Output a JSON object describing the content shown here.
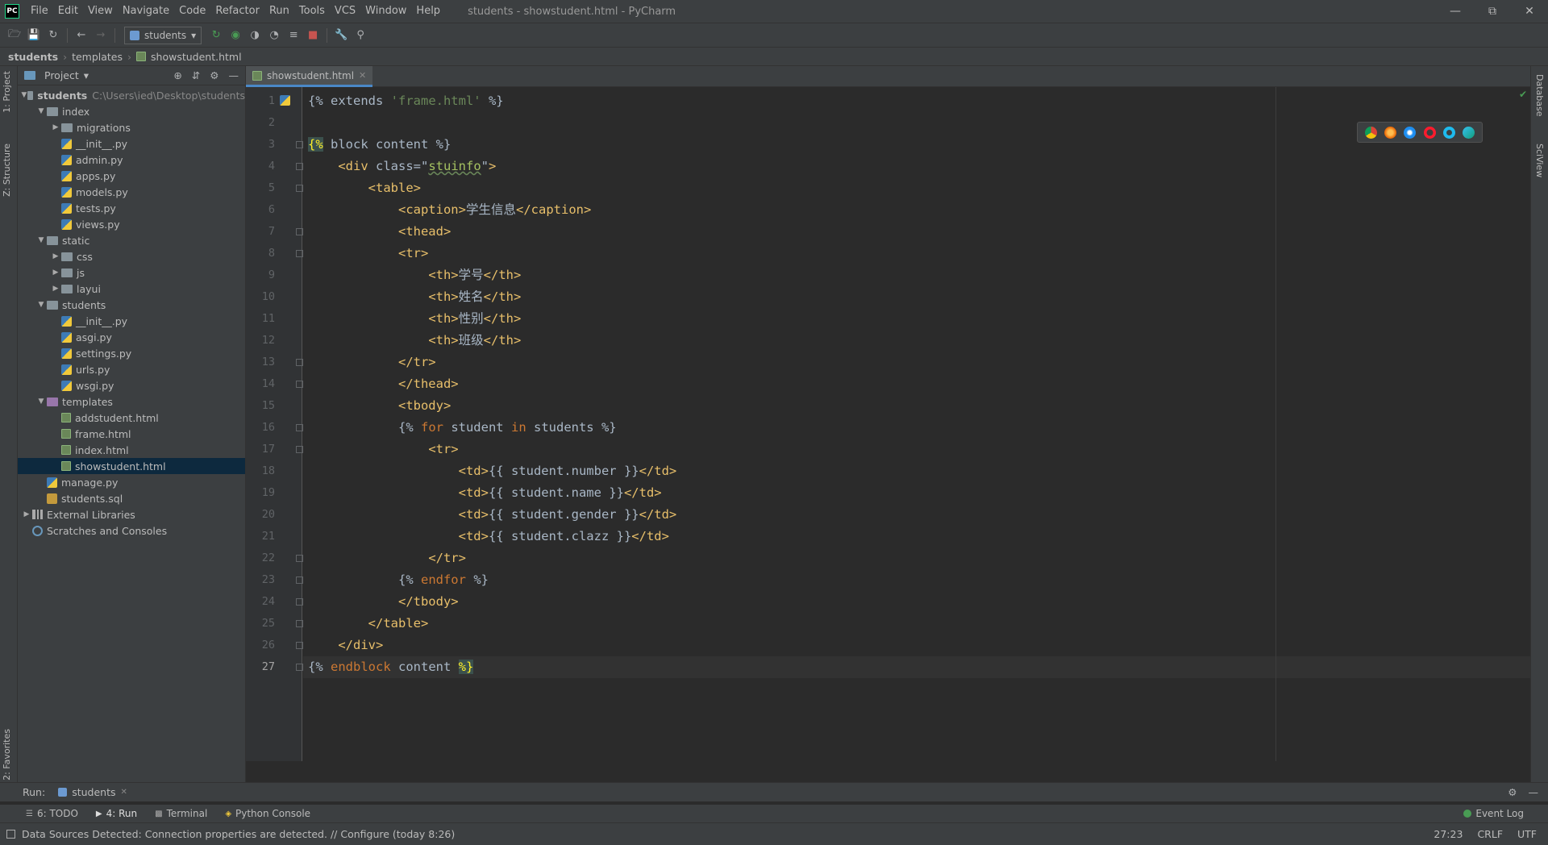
{
  "titlebar": {
    "logo": "PC",
    "menu": [
      "File",
      "Edit",
      "View",
      "Navigate",
      "Code",
      "Refactor",
      "Run",
      "Tools",
      "VCS",
      "Window",
      "Help"
    ],
    "window_title": "students - showstudent.html - PyCharm"
  },
  "toolbar": {
    "run_config": "students"
  },
  "breadcrumb": [
    "students",
    "templates",
    "showstudent.html"
  ],
  "left_strip": {
    "project_tab": "1: Project",
    "structure_tab": "Z: Structure",
    "favorites_tab": "2: Favorites"
  },
  "right_strip": {
    "database_tab": "Database",
    "sciview_tab": "SciView"
  },
  "project_panel": {
    "title": "Project",
    "root_path": "C:\\Users\\ied\\Desktop\\students",
    "tree": [
      {
        "label": "students",
        "level": 0,
        "type": "folder-root",
        "expanded": true,
        "bold": true
      },
      {
        "label": "index",
        "level": 1,
        "type": "folder",
        "expanded": true
      },
      {
        "label": "migrations",
        "level": 2,
        "type": "folder",
        "expanded": false
      },
      {
        "label": "__init__.py",
        "level": 2,
        "type": "py"
      },
      {
        "label": "admin.py",
        "level": 2,
        "type": "py"
      },
      {
        "label": "apps.py",
        "level": 2,
        "type": "py"
      },
      {
        "label": "models.py",
        "level": 2,
        "type": "py"
      },
      {
        "label": "tests.py",
        "level": 2,
        "type": "py"
      },
      {
        "label": "views.py",
        "level": 2,
        "type": "py"
      },
      {
        "label": "static",
        "level": 1,
        "type": "folder",
        "expanded": true
      },
      {
        "label": "css",
        "level": 2,
        "type": "folder",
        "expanded": false
      },
      {
        "label": "js",
        "level": 2,
        "type": "folder",
        "expanded": false
      },
      {
        "label": "layui",
        "level": 2,
        "type": "folder",
        "expanded": false
      },
      {
        "label": "students",
        "level": 1,
        "type": "folder",
        "expanded": true
      },
      {
        "label": "__init__.py",
        "level": 2,
        "type": "py"
      },
      {
        "label": "asgi.py",
        "level": 2,
        "type": "py"
      },
      {
        "label": "settings.py",
        "level": 2,
        "type": "py"
      },
      {
        "label": "urls.py",
        "level": 2,
        "type": "py"
      },
      {
        "label": "wsgi.py",
        "level": 2,
        "type": "py"
      },
      {
        "label": "templates",
        "level": 1,
        "type": "folder-purple",
        "expanded": true
      },
      {
        "label": "addstudent.html",
        "level": 2,
        "type": "html"
      },
      {
        "label": "frame.html",
        "level": 2,
        "type": "html"
      },
      {
        "label": "index.html",
        "level": 2,
        "type": "html"
      },
      {
        "label": "showstudent.html",
        "level": 2,
        "type": "html",
        "selected": true
      },
      {
        "label": "manage.py",
        "level": 1,
        "type": "py"
      },
      {
        "label": "students.sql",
        "level": 1,
        "type": "sql"
      },
      {
        "label": "External Libraries",
        "level": 0,
        "type": "lib",
        "expanded": false
      },
      {
        "label": "Scratches and Consoles",
        "level": 0,
        "type": "scratch"
      }
    ]
  },
  "editor": {
    "tab": "showstudent.html",
    "current_line": 27,
    "lines": [
      [
        {
          "t": "{% extends ",
          "c": "plain"
        },
        {
          "t": "'frame.html'",
          "c": "str"
        },
        {
          "t": " %}",
          "c": "plain"
        }
      ],
      [],
      [
        {
          "t": "{%",
          "c": "hl"
        },
        {
          "t": " block content %}",
          "c": "plain"
        }
      ],
      [
        {
          "t": "    ",
          "c": "plain"
        },
        {
          "t": "<div ",
          "c": "tag"
        },
        {
          "t": "class=",
          "c": "plain"
        },
        {
          "t": "\"",
          "c": "plain"
        },
        {
          "t": "stuinfo",
          "c": "attrv"
        },
        {
          "t": "\"",
          "c": "plain"
        },
        {
          "t": ">",
          "c": "tag"
        }
      ],
      [
        {
          "t": "        ",
          "c": "plain"
        },
        {
          "t": "<table>",
          "c": "tag"
        }
      ],
      [
        {
          "t": "            ",
          "c": "plain"
        },
        {
          "t": "<caption>",
          "c": "tag"
        },
        {
          "t": "学生信息",
          "c": "cn"
        },
        {
          "t": "</caption>",
          "c": "tag"
        }
      ],
      [
        {
          "t": "            ",
          "c": "plain"
        },
        {
          "t": "<thead>",
          "c": "tag"
        }
      ],
      [
        {
          "t": "            ",
          "c": "plain"
        },
        {
          "t": "<tr>",
          "c": "tag"
        }
      ],
      [
        {
          "t": "                ",
          "c": "plain"
        },
        {
          "t": "<th>",
          "c": "tag"
        },
        {
          "t": "学号",
          "c": "cn"
        },
        {
          "t": "</th>",
          "c": "tag"
        }
      ],
      [
        {
          "t": "                ",
          "c": "plain"
        },
        {
          "t": "<th>",
          "c": "tag"
        },
        {
          "t": "姓名",
          "c": "cn"
        },
        {
          "t": "</th>",
          "c": "tag"
        }
      ],
      [
        {
          "t": "                ",
          "c": "plain"
        },
        {
          "t": "<th>",
          "c": "tag"
        },
        {
          "t": "性别",
          "c": "cn"
        },
        {
          "t": "</th>",
          "c": "tag"
        }
      ],
      [
        {
          "t": "                ",
          "c": "plain"
        },
        {
          "t": "<th>",
          "c": "tag"
        },
        {
          "t": "班级",
          "c": "cn"
        },
        {
          "t": "</th>",
          "c": "tag"
        }
      ],
      [
        {
          "t": "            ",
          "c": "plain"
        },
        {
          "t": "</tr>",
          "c": "tag"
        }
      ],
      [
        {
          "t": "            ",
          "c": "plain"
        },
        {
          "t": "</thead>",
          "c": "tag"
        }
      ],
      [
        {
          "t": "            ",
          "c": "plain"
        },
        {
          "t": "<tbody>",
          "c": "tag"
        }
      ],
      [
        {
          "t": "            ",
          "c": "plain"
        },
        {
          "t": "{% ",
          "c": "plain"
        },
        {
          "t": "for",
          "c": "tpl"
        },
        {
          "t": " student ",
          "c": "plain"
        },
        {
          "t": "in",
          "c": "tpl"
        },
        {
          "t": " students %}",
          "c": "plain"
        }
      ],
      [
        {
          "t": "                ",
          "c": "plain"
        },
        {
          "t": "<tr>",
          "c": "tag"
        }
      ],
      [
        {
          "t": "                    ",
          "c": "plain"
        },
        {
          "t": "<td>",
          "c": "tag"
        },
        {
          "t": "{{ student.number }}",
          "c": "plain"
        },
        {
          "t": "</td>",
          "c": "tag"
        }
      ],
      [
        {
          "t": "                    ",
          "c": "plain"
        },
        {
          "t": "<td>",
          "c": "tag"
        },
        {
          "t": "{{ student.name }}",
          "c": "plain"
        },
        {
          "t": "</td>",
          "c": "tag"
        }
      ],
      [
        {
          "t": "                    ",
          "c": "plain"
        },
        {
          "t": "<td>",
          "c": "tag"
        },
        {
          "t": "{{ student.gender }}",
          "c": "plain"
        },
        {
          "t": "</td>",
          "c": "tag"
        }
      ],
      [
        {
          "t": "                    ",
          "c": "plain"
        },
        {
          "t": "<td>",
          "c": "tag"
        },
        {
          "t": "{{ student.clazz }}",
          "c": "plain"
        },
        {
          "t": "</td>",
          "c": "tag"
        }
      ],
      [
        {
          "t": "                ",
          "c": "plain"
        },
        {
          "t": "</tr>",
          "c": "tag"
        }
      ],
      [
        {
          "t": "            ",
          "c": "plain"
        },
        {
          "t": "{% ",
          "c": "plain"
        },
        {
          "t": "endfor",
          "c": "tpl"
        },
        {
          "t": " %}",
          "c": "plain"
        }
      ],
      [
        {
          "t": "            ",
          "c": "plain"
        },
        {
          "t": "</tbody>",
          "c": "tag"
        }
      ],
      [
        {
          "t": "        ",
          "c": "plain"
        },
        {
          "t": "</table>",
          "c": "tag"
        }
      ],
      [
        {
          "t": "    ",
          "c": "plain"
        },
        {
          "t": "</div>",
          "c": "tag"
        }
      ],
      [
        {
          "t": "{% ",
          "c": "plain"
        },
        {
          "t": "endblock",
          "c": "tpl"
        },
        {
          "t": " content ",
          "c": "plain"
        },
        {
          "t": "%}",
          "c": "hl"
        }
      ]
    ]
  },
  "run_bar": {
    "label": "Run:",
    "tab": "students"
  },
  "bottom_tabs": [
    {
      "label": "6: TODO",
      "icon": "list-icon"
    },
    {
      "label": "4: Run",
      "icon": "play-icon",
      "active": true
    },
    {
      "label": "Terminal",
      "icon": "terminal-icon"
    },
    {
      "label": "Python Console",
      "icon": "python-icon"
    }
  ],
  "event_log": "Event Log",
  "status": {
    "message": "Data Sources Detected: Connection properties are detected. // Configure (today 8:26)",
    "position": "27:23",
    "line_ending": "CRLF",
    "encoding": "UTF"
  },
  "colors": {
    "keyword": "#cc7832",
    "tag": "#e8bf6a",
    "string": "#6a8759",
    "text": "#a9b7c6",
    "selection": "#0d293e"
  }
}
